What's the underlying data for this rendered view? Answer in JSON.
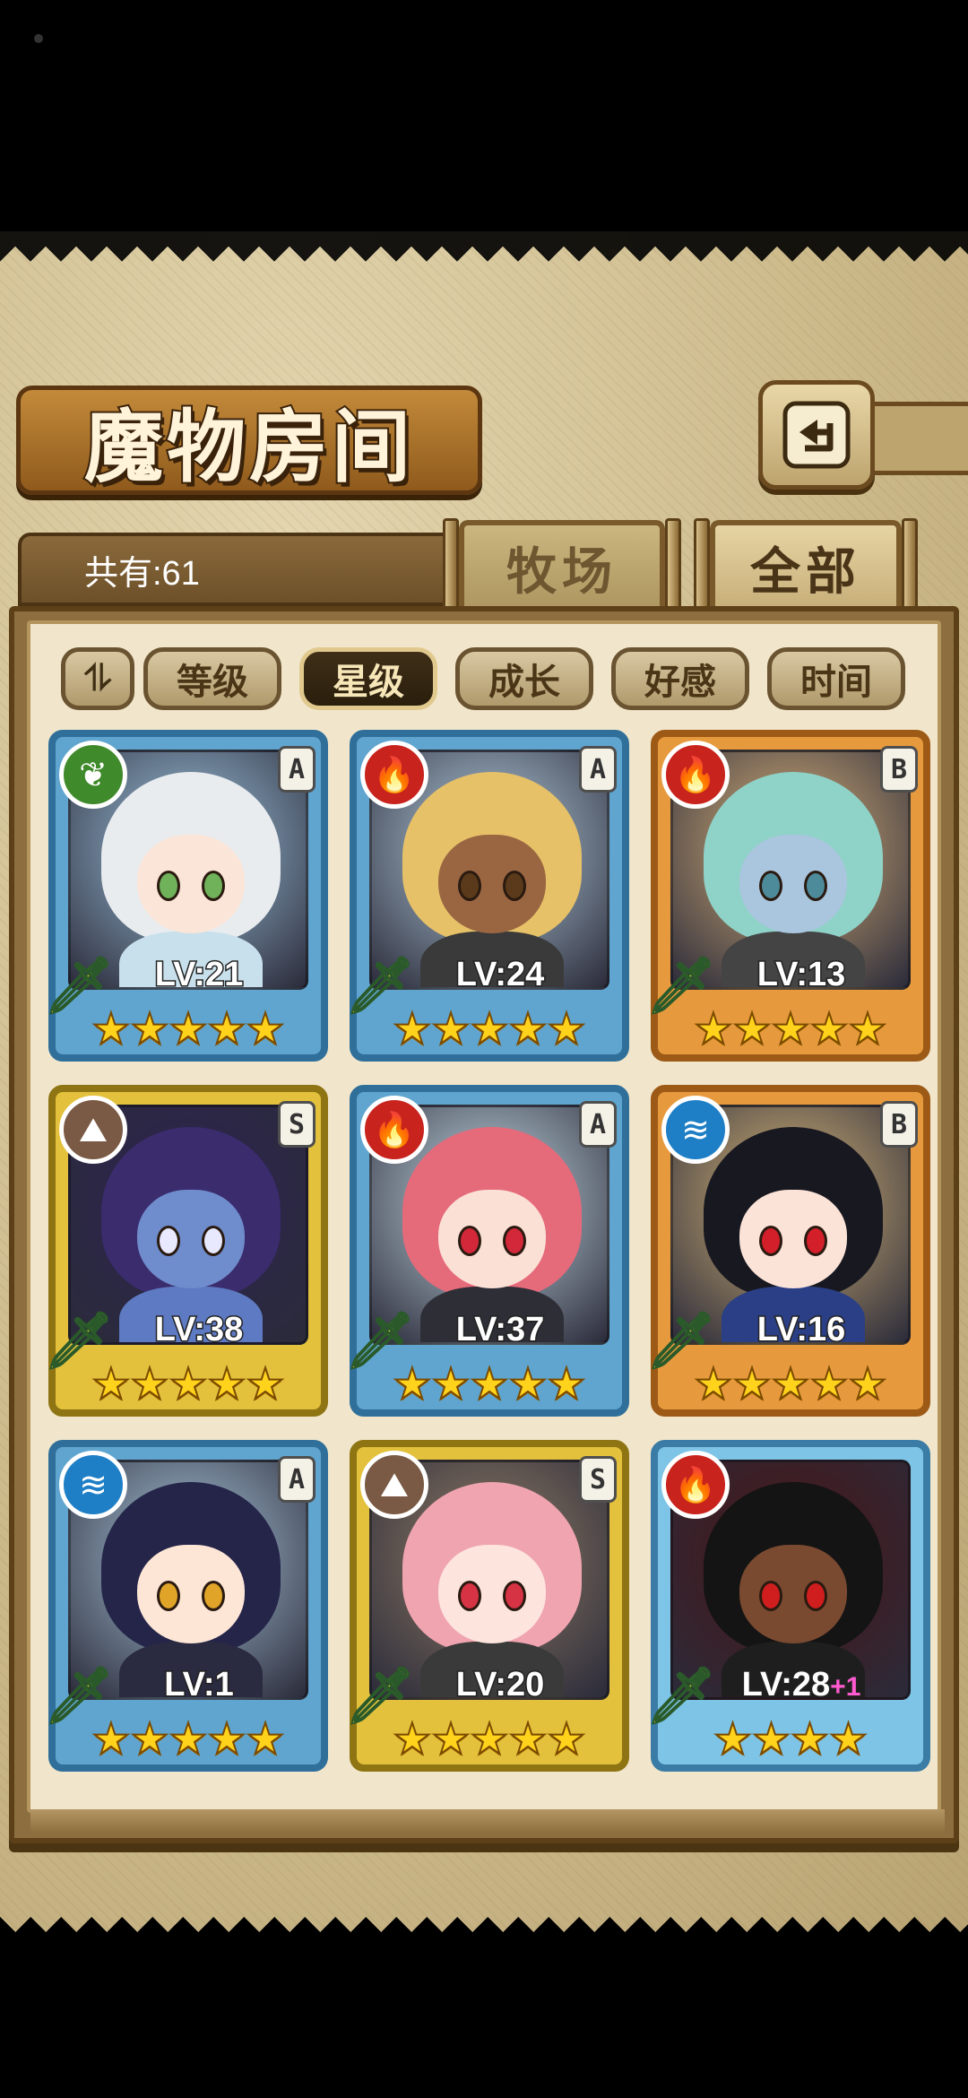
{
  "header": {
    "title": "魔物房间",
    "back_icon": "return-arrow-icon"
  },
  "summary": {
    "count_text": "共有:61"
  },
  "tabs": [
    {
      "label": "牧场",
      "active": false
    },
    {
      "label": "全部",
      "active": true
    }
  ],
  "sort": {
    "toggle_icon": "sort-order-icon",
    "options": [
      {
        "label": "等级",
        "active": false
      },
      {
        "label": "星级",
        "active": true
      },
      {
        "label": "成长",
        "active": false
      },
      {
        "label": "好感",
        "active": false
      },
      {
        "label": "时间",
        "active": false
      }
    ]
  },
  "monsters": [
    {
      "level": "LV:21",
      "plus": "",
      "stars": "★★★★★",
      "star_count": 5,
      "element": "leaf",
      "element_icon": "leaf-element-icon",
      "grade": "A",
      "frame": "A",
      "hair": "#e8ecef",
      "skin": "#fbe5d8",
      "eye": "#6fb25a",
      "bg": "#9ec4de",
      "outfit": "#c8e0ec"
    },
    {
      "level": "LV:24",
      "plus": "",
      "stars": "★★★★★",
      "star_count": 5,
      "element": "fire",
      "element_icon": "fire-element-icon",
      "grade": "A",
      "frame": "A",
      "hair": "#e7c168",
      "skin": "#9a6642",
      "eye": "#5a3a1a",
      "bg": "#b5cfe0",
      "outfit": "#3a3a3a"
    },
    {
      "level": "LV:13",
      "plus": "",
      "stars": "★★★★★",
      "star_count": 5,
      "element": "fire",
      "element_icon": "fire-element-icon",
      "grade": "B",
      "frame": "B",
      "hair": "#8fd2c8",
      "skin": "#a9c6de",
      "eye": "#4d8a9a",
      "bg": "#d9b27a",
      "outfit": "#444"
    },
    {
      "level": "LV:38",
      "plus": "",
      "stars": "★★★★★",
      "star_count": 5,
      "element": "earth",
      "element_icon": "earth-element-icon",
      "grade": "S",
      "frame": "S",
      "hair": "#3b2c6e",
      "skin": "#6f8ccc",
      "eye": "#e8e8ff",
      "bg": "#2c2350",
      "outfit": "#5d7ac2"
    },
    {
      "level": "LV:37",
      "plus": "",
      "stars": "★★★★★",
      "star_count": 5,
      "element": "fire",
      "element_icon": "fire-element-icon",
      "grade": "A",
      "frame": "A",
      "hair": "#e56a7a",
      "skin": "#fbe0d6",
      "eye": "#d2283a",
      "bg": "#c6dbe6",
      "outfit": "#2e2e36"
    },
    {
      "level": "LV:16",
      "plus": "",
      "stars": "★★★★★",
      "star_count": 5,
      "element": "water",
      "element_icon": "water-element-icon",
      "grade": "B",
      "frame": "B",
      "hair": "#181820",
      "skin": "#fbe3d8",
      "eye": "#d21f2a",
      "bg": "#d7b679",
      "outfit": "#2b3f86"
    },
    {
      "level": "LV:1",
      "plus": "",
      "stars": "★★★★★",
      "star_count": 5,
      "element": "water",
      "element_icon": "water-element-icon",
      "grade": "A",
      "frame": "A",
      "hair": "#25254a",
      "skin": "#fde6d6",
      "eye": "#e0a428",
      "bg": "#a9c7dc",
      "outfit": "#2a2a40"
    },
    {
      "level": "LV:20",
      "plus": "",
      "stars": "★★★★★",
      "star_count": 5,
      "element": "earth",
      "element_icon": "earth-element-icon",
      "grade": "S",
      "frame": "S",
      "hair": "#f0a4b0",
      "skin": "#fde4dc",
      "eye": "#d63344",
      "bg": "#8f7b64",
      "outfit": "#3a3a3a"
    },
    {
      "level": "LV:28",
      "plus": "+1",
      "stars": "★★★★",
      "star_count": 4,
      "element": "fire",
      "element_icon": "fire-element-icon",
      "grade": "",
      "frame": "rare",
      "hair": "#141414",
      "skin": "#7a4a30",
      "eye": "#d01e1e",
      "bg": "#4a1414",
      "outfit": "#1e1e1e"
    }
  ],
  "colors": {
    "accent": "#8c6e3f",
    "active_sort": "#2f2312",
    "star": "#ffd21c"
  }
}
